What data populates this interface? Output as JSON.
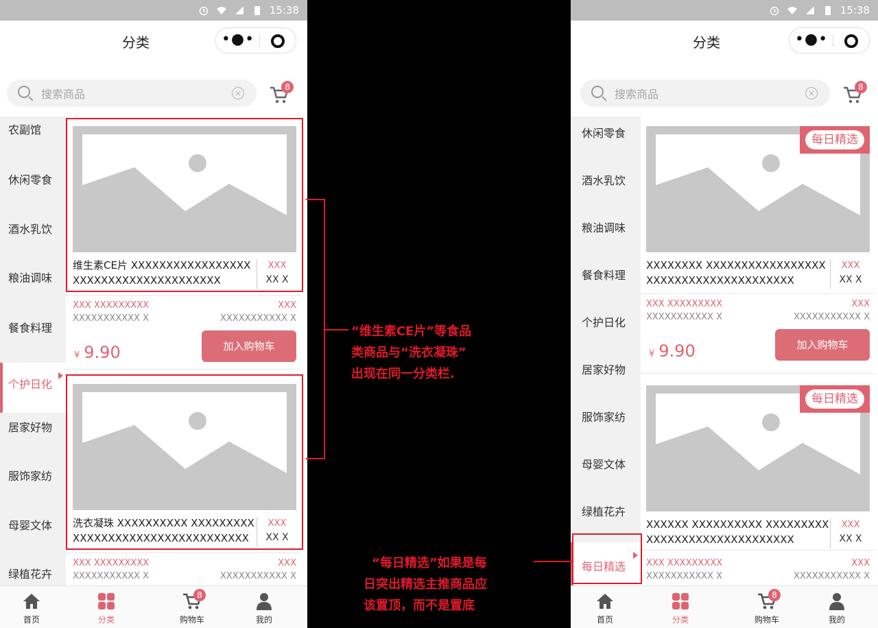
{
  "status": {
    "time": "15:38"
  },
  "nav": {
    "title": "分类"
  },
  "search": {
    "placeholder": "搜索商品",
    "clear": "×"
  },
  "cart_badge": "8",
  "sidebar_left": [
    "农副馆",
    "休闲零食",
    "酒水乳饮",
    "粮油调味",
    "餐食料理",
    "个护日化",
    "居家好物",
    "服饰家纺",
    "母婴文体",
    "绿植花卉"
  ],
  "sidebar_right": [
    "休闲零食",
    "酒水乳饮",
    "粮油调味",
    "餐食料理",
    "个护日化",
    "居家好物",
    "服饰家纺",
    "母婴文体",
    "绿植花卉",
    "每日精选"
  ],
  "products_left": [
    {
      "name": "维生素CE片 XXXXXXXXXXXXXXXXXXXXXXXXXXXXXXXXXXXXXX",
      "price_red": "XXX",
      "price_sub": "XX X",
      "spec1_l": "XXX XXXXXXXXX",
      "spec1_r": "XXX",
      "spec2_l": "XXXXXXXXXXX X",
      "spec2_r": "XXXXXXXXXXX X",
      "currency": "¥",
      "price": "9.90",
      "add": "加入购物车"
    },
    {
      "name": "洗衣凝珠 XXXXXXXXXX XXXXXXXXXXXXXXXXXXXXXXXXXXXXXXXXXX",
      "price_red": "XXX",
      "price_sub": "XX X",
      "spec1_l": "XXX XXXXXXXXX",
      "spec1_r": "XXX",
      "spec2_l": "XXXXXXXXXXX X",
      "spec2_r": "XXXXXXXXXXX X"
    }
  ],
  "products_right": [
    {
      "ribbon": "每日精选",
      "name": "XXXXXXXX XXXXXXXXXXXXXXXXXXXXXXXXXXXXXXXXXXXXXX",
      "price_red": "XXX",
      "price_sub": "XX X",
      "spec1_l": "XXX XXXXXXXXX",
      "spec1_r": "XXX",
      "spec2_l": "XXXXXXXXXXX X",
      "spec2_r": "XXXXXXXXXXX X",
      "currency": "¥",
      "price": "9.90",
      "add": "加入购物车"
    },
    {
      "ribbon": "每日精选",
      "name": "XXXXXX XXXXXXXXXX XXXXXXXXXXXXXXXXXXXXXXXXXXXXXX",
      "price_red": "XXX",
      "price_sub": "XX X",
      "spec1_l": "XXX XXXXXXXXX",
      "spec1_r": "XXX",
      "spec2_l": "XXXXXXXXXXX X",
      "spec2_r": "XXXXXXXXXXX X"
    }
  ],
  "tabs": [
    {
      "label": "首页",
      "icon": "home-icon"
    },
    {
      "label": "分类",
      "icon": "category-icon"
    },
    {
      "label": "购物车",
      "icon": "cart-icon",
      "badge": "8"
    },
    {
      "label": "我的",
      "icon": "user-icon"
    }
  ],
  "annotations": {
    "a1": [
      "“维生素CE片”等食品",
      "类商品与“洗衣凝珠”",
      "出现在同一分类栏."
    ],
    "a2": [
      "“每日精选”如果是每",
      "日突出精选主推商品应",
      "该置顶，而不是置底"
    ]
  },
  "colors": {
    "accent": "#e06371",
    "annotation": "#e0192a"
  }
}
